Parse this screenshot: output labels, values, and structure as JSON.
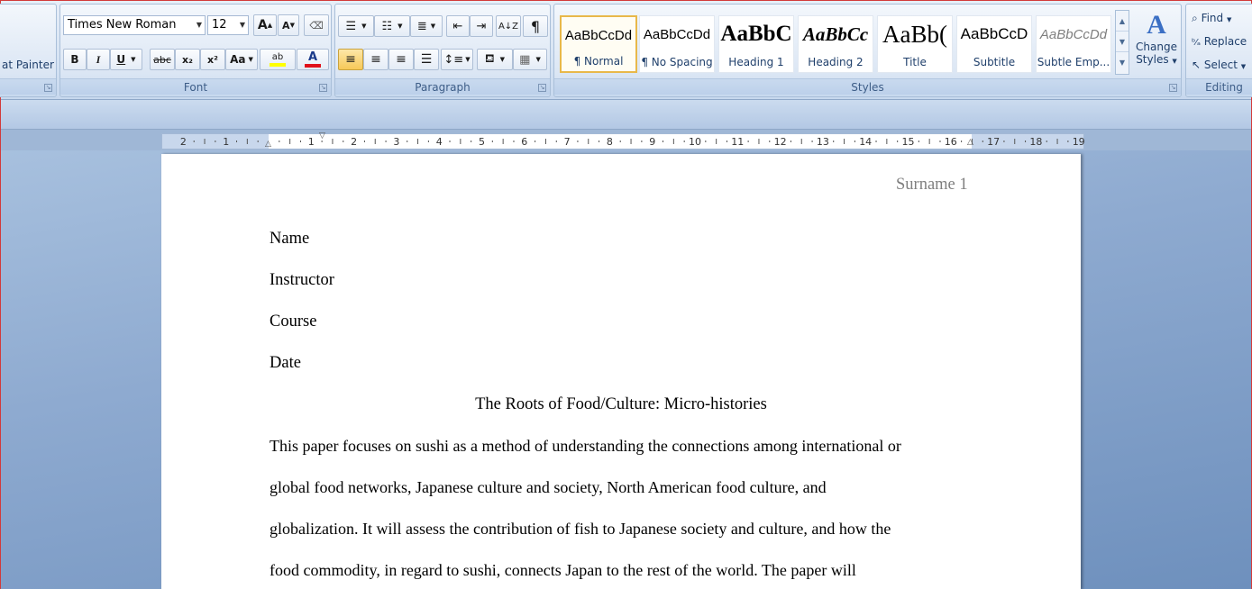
{
  "clipboard": {
    "format_painter_label": "at Painter"
  },
  "font": {
    "group_label": "Font",
    "font_name": "Times New Roman",
    "font_size": "12",
    "grow_label": "A",
    "shrink_label": "A",
    "clear_label": "ᴬᵇ",
    "bold": "B",
    "italic": "I",
    "underline": "U",
    "strike": "abc",
    "subscript": "x₂",
    "superscript": "x²",
    "change_case": "Aa",
    "highlight_label": "ab",
    "font_color_label": "A",
    "highlight_color": "#ffff00",
    "font_color": "#e0101a"
  },
  "paragraph": {
    "group_label": "Paragraph",
    "bullets_icon": "bullets-icon",
    "numbering_icon": "numbering-icon",
    "multilevel_icon": "multilevel-list-icon",
    "sort_label": "A↓Z",
    "pilcrow": "¶"
  },
  "styles": {
    "group_label": "Styles",
    "items": [
      {
        "sample": "AaBbCcDd",
        "name": "¶ Normal"
      },
      {
        "sample": "AaBbCcDd",
        "name": "¶ No Spacing"
      },
      {
        "sample": "AaBbC",
        "name": "Heading 1"
      },
      {
        "sample": "AaBbCc",
        "name": "Heading 2"
      },
      {
        "sample": "AaBb(",
        "name": "Title"
      },
      {
        "sample": "AaBbCcD",
        "name": "Subtitle"
      },
      {
        "sample": "AaBbCcDd",
        "name": "Subtle Emp..."
      }
    ],
    "change_styles_line1": "Change",
    "change_styles_line2": "Styles"
  },
  "editing": {
    "group_label": "Editing",
    "find": "Find",
    "replace": "Replace",
    "select": "Select"
  },
  "ruler": {
    "left_numbers": [
      "2",
      "1"
    ],
    "right_numbers": [
      "1",
      "2",
      "3",
      "4",
      "5",
      "6",
      "7",
      "8",
      "9",
      "10",
      "11",
      "12",
      "13",
      "14",
      "15",
      "16",
      "17",
      "18",
      "19"
    ]
  },
  "document": {
    "header_text": "Surname 1",
    "lines": [
      "Name",
      "Instructor",
      "Course",
      "Date"
    ],
    "title": "The Roots of Food/Culture: Micro-histories",
    "body_lines": [
      "This paper focuses on sushi as a method of understanding the connections among  international or",
      "global food networks, Japanese culture and society, North American food culture, and",
      "globalization. It will assess the contribution of fish to Japanese society and culture, and how the",
      "food commodity,  in regard to sushi, connects Japan to the rest of the world.  The paper will"
    ]
  }
}
